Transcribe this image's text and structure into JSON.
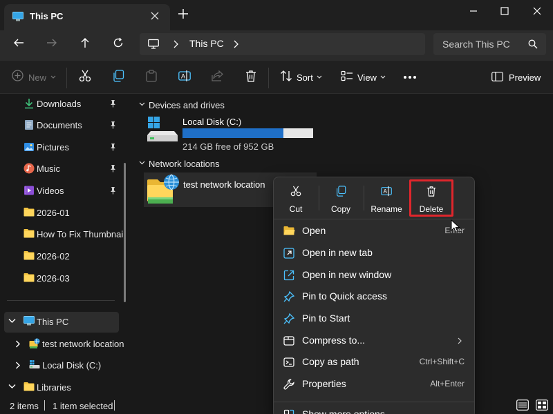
{
  "window": {
    "tab_title": "This PC"
  },
  "address": {
    "crumb": "This PC",
    "search_placeholder": "Search This PC"
  },
  "toolbar": {
    "new_label": "New",
    "sort_label": "Sort",
    "view_label": "View",
    "preview_label": "Preview"
  },
  "sidebar": {
    "quick_access": [
      {
        "label": "Downloads",
        "icon": "download-icon"
      },
      {
        "label": "Documents",
        "icon": "documents-icon"
      },
      {
        "label": "Pictures",
        "icon": "pictures-icon"
      },
      {
        "label": "Music",
        "icon": "music-icon"
      },
      {
        "label": "Videos",
        "icon": "videos-icon"
      },
      {
        "label": "2026-01",
        "icon": "folder-icon"
      },
      {
        "label": "How To Fix Thumbnail",
        "icon": "folder-icon"
      },
      {
        "label": "2026-02",
        "icon": "folder-icon"
      },
      {
        "label": "2026-03",
        "icon": "folder-icon"
      }
    ],
    "tree": {
      "this_pc": "This PC",
      "net_location": "test network location",
      "local_disk": "Local Disk (C:)",
      "libraries": "Libraries"
    }
  },
  "main": {
    "devices_group": "Devices and drives",
    "drive": {
      "name": "Local Disk (C:)",
      "free_text": "214 GB free of 952 GB",
      "used_fraction": 0.775
    },
    "network_group": "Network locations",
    "network_item": "test network location"
  },
  "context_menu": {
    "quick_actions": [
      {
        "label": "Cut",
        "icon": "scissors-icon"
      },
      {
        "label": "Copy",
        "icon": "copy-icon"
      },
      {
        "label": "Rename",
        "icon": "rename-icon"
      },
      {
        "label": "Delete",
        "icon": "trash-icon"
      }
    ],
    "items": [
      {
        "label": "Open",
        "shortcut": "Enter",
        "icon": "folder-open-icon"
      },
      {
        "label": "Open in new tab",
        "shortcut": "",
        "icon": "new-tab-icon"
      },
      {
        "label": "Open in new window",
        "shortcut": "",
        "icon": "new-window-icon"
      },
      {
        "label": "Pin to Quick access",
        "shortcut": "",
        "icon": "pin-icon"
      },
      {
        "label": "Pin to Start",
        "shortcut": "",
        "icon": "pin-icon"
      },
      {
        "label": "Compress to...",
        "shortcut": "",
        "icon": "archive-icon"
      },
      {
        "label": "Copy as path",
        "shortcut": "Ctrl+Shift+C",
        "icon": "path-icon"
      },
      {
        "label": "Properties",
        "shortcut": "Alt+Enter",
        "icon": "wrench-icon"
      }
    ],
    "more": {
      "label": "Show more options",
      "icon": "more-options-icon"
    }
  },
  "status": {
    "items_count": "2 items",
    "selected": "1 item selected"
  },
  "colors": {
    "accent": "#1f6fc7",
    "highlight": "#e0262c"
  }
}
